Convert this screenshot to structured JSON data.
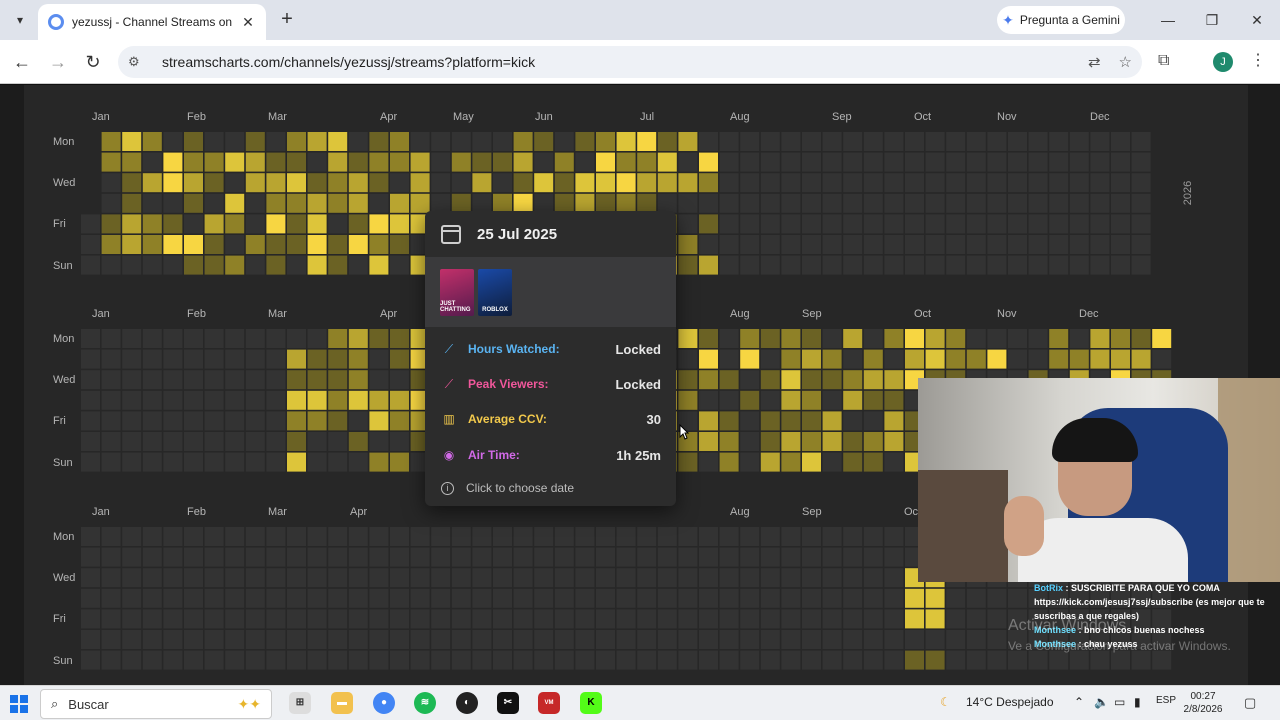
{
  "browser": {
    "tab_title": "yezussj - Channel Streams on Kick: Vie",
    "new_tab": "+",
    "gemini": "Pregunta a Gemini",
    "url": "streamscharts.com/channels/yezussj/streams?platform=kick",
    "avatar": "J"
  },
  "heatmap": {
    "rows": [
      {
        "months": [
          "Jan",
          "Feb",
          "Mar",
          "Apr",
          "May",
          "Jun",
          "Jul",
          "Aug",
          "Sep",
          "Oct",
          "Nov",
          "Dec"
        ],
        "year": "2026"
      },
      {
        "months": [
          "Jan",
          "Feb",
          "Mar",
          "Apr",
          "Aug",
          "Sep",
          "Oct",
          "Nov",
          "Dec"
        ]
      },
      {
        "months": [
          "Jan",
          "Feb",
          "Mar",
          "Apr",
          "Aug",
          "Sep",
          "Oct"
        ]
      }
    ],
    "days": [
      "Mon",
      "Wed",
      "Fri",
      "Sun"
    ],
    "colors": {
      "empty": "#333333",
      "l1": "#6b6224",
      "l2": "#8f8127",
      "l3": "#b9a530",
      "l4": "#ddc53a",
      "l5": "#f7d642"
    }
  },
  "tooltip": {
    "date": "25 Jul 2025",
    "games": [
      "JUST CHATTING",
      "ROBLOX"
    ],
    "hours_watched_label": "Hours Watched:",
    "hours_watched_value": "Locked",
    "peak_viewers_label": "Peak Viewers:",
    "peak_viewers_value": "Locked",
    "avg_ccv_label": "Average CCV:",
    "avg_ccv_value": "30",
    "air_time_label": "Air Time:",
    "air_time_value": "1h 25m",
    "help": "Click to choose date",
    "accent_colors": {
      "hours": "#5ab4f2",
      "peak": "#f0579b",
      "ccv": "#f2c94c",
      "air": "#d26ae8"
    }
  },
  "chat": [
    {
      "user": "BotRix",
      "text": ": SUSCRIBITE PARA QUE YO COMA https://kick.com/jesusj7ssj/subscribe (es mejor que te suscribas a que regales)"
    },
    {
      "user": "Monthsee",
      "text": ": bno chicos buenas nochess"
    },
    {
      "user": "Monthsee",
      "text": ": chau yezuss"
    }
  ],
  "watermark": {
    "title": "Activar Windows",
    "subtitle": "Ve a Configuración para activar Windows."
  },
  "taskbar": {
    "search": "Buscar",
    "weather": "14°C Despejado",
    "lang": "ESP",
    "time": "00:27",
    "date": "2/8/2026"
  }
}
